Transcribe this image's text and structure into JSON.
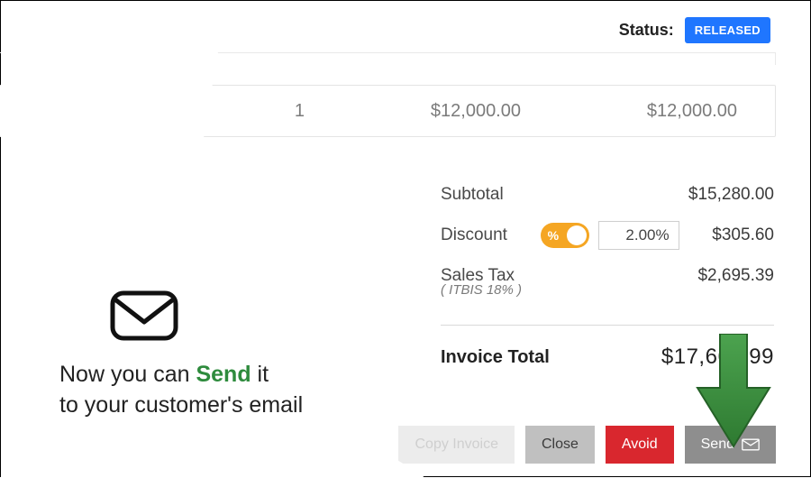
{
  "status": {
    "label": "Status:",
    "badge": "RELEASED"
  },
  "line_item": {
    "qty": "1",
    "price": "$12,000.00",
    "amount": "$12,000.00"
  },
  "summary": {
    "subtotal": {
      "label": "Subtotal",
      "value": "$15,280.00"
    },
    "discount": {
      "label": "Discount",
      "pct_symbol": "%",
      "input": "2.00%",
      "value": "$305.60"
    },
    "tax": {
      "label": "Sales Tax",
      "sub": "( ITBIS 18% )",
      "value": "$2,695.39"
    },
    "total": {
      "label": "Invoice Total",
      "value": "$17,669.99"
    }
  },
  "actions": {
    "copy": "Copy Invoice",
    "close": "Close",
    "avoid": "Avoid",
    "send": "Send"
  },
  "promo": {
    "line1_pre": "Now you can ",
    "line1_send": "Send",
    "line1_post": " it",
    "line2": "to your customer's email"
  }
}
